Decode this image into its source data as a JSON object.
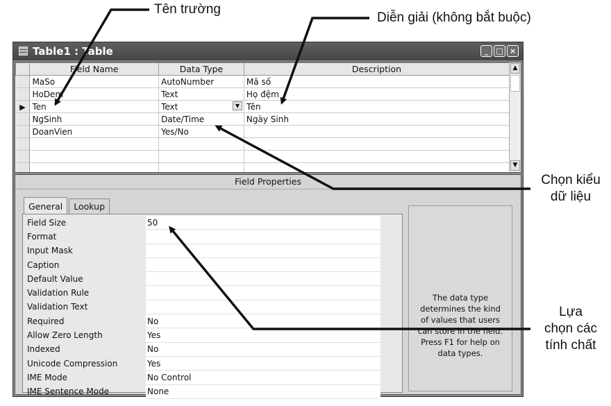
{
  "annotations": {
    "field_name": "Tên trường",
    "description": "Diễn giải (không bắt buộc)",
    "data_type_lines": [
      "Chọn kiểu",
      "dữ liệu"
    ],
    "properties_lines": [
      "Lựa",
      "chọn các",
      "tính chất"
    ]
  },
  "window": {
    "title": "Table1 : Table",
    "buttons": [
      "_",
      "□",
      "×"
    ]
  },
  "grid": {
    "headers": [
      "Field Name",
      "Data Type",
      "Description"
    ],
    "rows": [
      {
        "field": "MaSo",
        "type": "AutoNumber",
        "desc": "Mã số"
      },
      {
        "field": "HoDem",
        "type": "Text",
        "desc": "Họ đệm"
      },
      {
        "field": "Ten",
        "type": "Text",
        "desc": "Tên",
        "current": true
      },
      {
        "field": "NgSinh",
        "type": "Date/Time",
        "desc": "Ngày Sinh"
      },
      {
        "field": "DoanVien",
        "type": "Yes/No",
        "desc": ""
      },
      {
        "field": "",
        "type": "",
        "desc": ""
      },
      {
        "field": "",
        "type": "",
        "desc": ""
      },
      {
        "field": "",
        "type": "",
        "desc": ""
      }
    ],
    "current_marker": "▶"
  },
  "properties": {
    "title": "Field Properties",
    "tabs": [
      "General",
      "Lookup"
    ],
    "items": [
      {
        "label": "Field Size",
        "value": "50"
      },
      {
        "label": "Format",
        "value": ""
      },
      {
        "label": "Input Mask",
        "value": ""
      },
      {
        "label": "Caption",
        "value": ""
      },
      {
        "label": "Default Value",
        "value": ""
      },
      {
        "label": "Validation Rule",
        "value": ""
      },
      {
        "label": "Validation Text",
        "value": ""
      },
      {
        "label": "Required",
        "value": "No"
      },
      {
        "label": "Allow Zero Length",
        "value": "Yes"
      },
      {
        "label": "Indexed",
        "value": "No"
      },
      {
        "label": "Unicode Compression",
        "value": "Yes"
      },
      {
        "label": "IME Mode",
        "value": "No Control"
      },
      {
        "label": "IME Sentence Mode",
        "value": "None"
      }
    ],
    "help_lines": [
      "The data type",
      "determines the kind",
      "of values that users",
      "can store in the field.",
      "Press F1 for help on",
      "data types."
    ]
  }
}
